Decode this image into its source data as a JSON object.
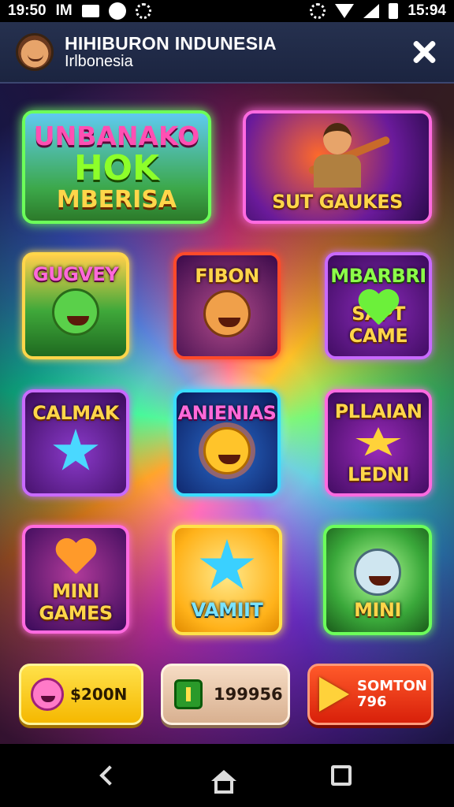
{
  "status_bar": {
    "time_left": "19:50",
    "carrier": "IM",
    "time_right": "15:94",
    "icons": [
      "notification-box-icon",
      "clock-icon",
      "gear-icon",
      "bluetooth-icon",
      "wifi-icon",
      "signal-icon",
      "battery-icon"
    ]
  },
  "header": {
    "title": "HIHIBURON INDUNESIA",
    "subtitle": "Irlbonesia",
    "close_icon": "close-icon"
  },
  "tiles": [
    {
      "lines": [
        "UNBANAKO",
        "HOK",
        "MBERISA"
      ]
    },
    {
      "label": "SUT GAUKES"
    },
    {
      "label": "GUGVEY"
    },
    {
      "label": "FIBON"
    },
    {
      "label_top": "MBARBRI",
      "label_bottom": "SAPT CAME"
    },
    {
      "label": "CALMAK"
    },
    {
      "label": "ANIENIAS"
    },
    {
      "label_top": "PLLAIAN",
      "label_bottom": "LEDNI"
    },
    {
      "lines": [
        "MINI",
        "GAMES"
      ]
    },
    {
      "label": "VAMIIT"
    },
    {
      "label": "MINI"
    }
  ],
  "bottom_buttons": [
    {
      "label": "$200N",
      "icon": "smiley-coin-icon"
    },
    {
      "label": "199956",
      "icon": "cash-icon"
    },
    {
      "label_line1": "SOMTON",
      "label_line2": "796",
      "icon": "play-icon"
    }
  ],
  "nav_bar": {
    "icons": [
      "back-icon",
      "home-icon",
      "recent-apps-icon"
    ]
  },
  "colors": {
    "header_bg": "#1b2440",
    "status_bar_bg": "#000000",
    "accent_yellow": "#ffd64a",
    "accent_green": "#6cff5a",
    "accent_pink": "#ff6ae0"
  }
}
